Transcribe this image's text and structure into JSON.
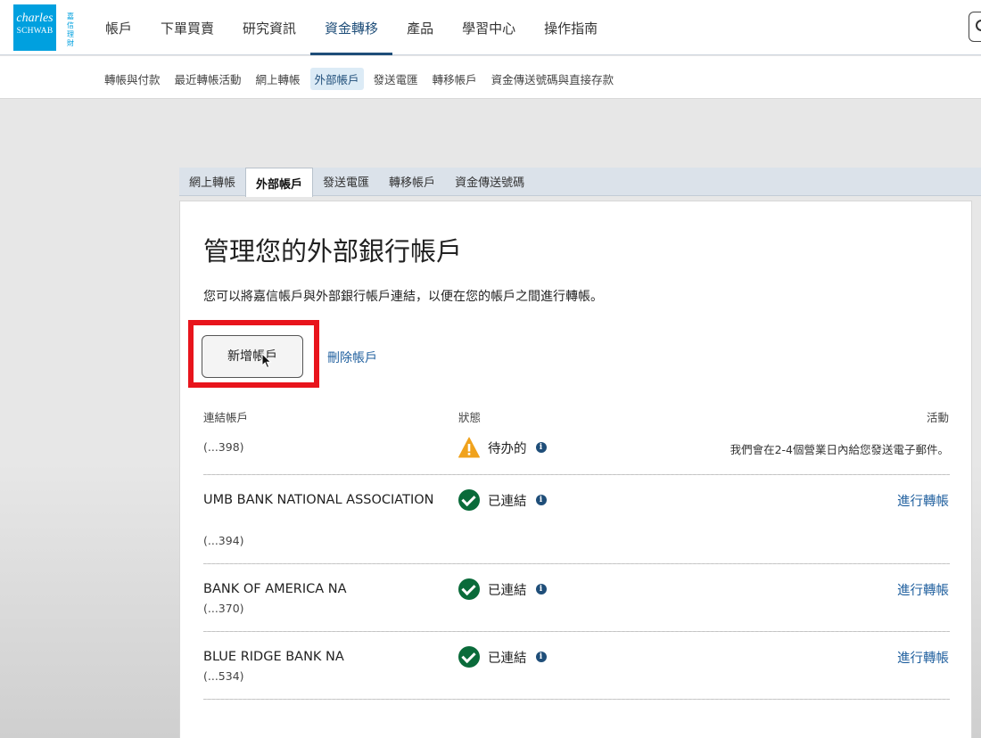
{
  "header": {
    "logo": {
      "line1": "charles",
      "line2": "SCHWAB",
      "cjk": [
        "嘉",
        "信",
        "理",
        "財"
      ]
    },
    "nav": [
      {
        "label": "帳戶"
      },
      {
        "label": "下單買賣"
      },
      {
        "label": "研究資訊"
      },
      {
        "label": "資金轉移",
        "active": true
      },
      {
        "label": "產品"
      },
      {
        "label": "學習中心"
      },
      {
        "label": "操作指南"
      }
    ],
    "search_icon": "search-icon"
  },
  "subnav": [
    {
      "label": "轉帳與付款"
    },
    {
      "label": "最近轉帳活動"
    },
    {
      "label": "網上轉帳"
    },
    {
      "label": "外部帳戶",
      "active": true
    },
    {
      "label": "發送電匯"
    },
    {
      "label": "轉移帳戶"
    },
    {
      "label": "資金傳送號碼與直接存款"
    }
  ],
  "tabs": [
    {
      "label": "網上轉帳"
    },
    {
      "label": "外部帳戶",
      "active": true
    },
    {
      "label": "發送電匯"
    },
    {
      "label": "轉移帳戶"
    },
    {
      "label": "資金傳送號碼"
    }
  ],
  "main": {
    "title": "管理您的外部銀行帳戶",
    "description": "您可以將嘉信帳戶與外部銀行帳戶連結，以便在您的帳戶之間進行轉帳。",
    "add_button": "新增帳戶",
    "remove_link": "刪除帳戶",
    "columns": {
      "linked": "連結帳戶",
      "status": "狀態",
      "activity": "活動"
    },
    "accounts": [
      {
        "name": "",
        "number": "(...398)",
        "status": "待办的",
        "status_icon": "warning-icon",
        "activity": "我們會在2-4個營業日內給您發送電子郵件。",
        "action": ""
      },
      {
        "name": "UMB BANK NATIONAL ASSOCIATION",
        "number": "(...394)",
        "status": "已連結",
        "status_icon": "check-circle-icon",
        "activity": "",
        "action": "進行轉帳"
      },
      {
        "name": "BANK OF AMERICA NA",
        "number": "(...370)",
        "status": "已連結",
        "status_icon": "check-circle-icon",
        "activity": "",
        "action": "進行轉帳"
      },
      {
        "name": "BLUE RIDGE BANK NA",
        "number": "(...534)",
        "status": "已連結",
        "status_icon": "check-circle-icon",
        "activity": "",
        "action": "進行轉帳"
      }
    ]
  },
  "colors": {
    "brand": "#00a0df",
    "nav_active": "#1f4e79",
    "link": "#1f5f9e",
    "success": "#0a6b3a",
    "warning": "#f0a21c",
    "highlight": "#e8141c"
  }
}
